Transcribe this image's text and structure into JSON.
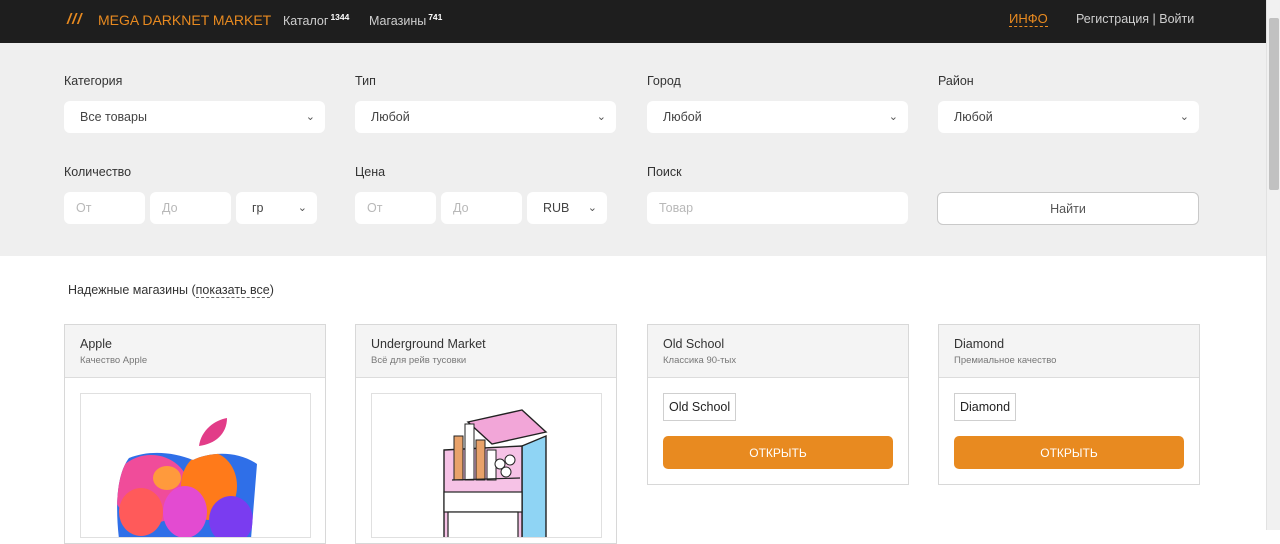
{
  "header": {
    "logo_mark": "///",
    "brand": "MEGA DARKNET MARKET",
    "catalog": {
      "label": "Каталог",
      "count": "1344"
    },
    "shops": {
      "label": "Магазины",
      "count": "741"
    },
    "info": "ИНФО",
    "auth": "Регистрация | Войти"
  },
  "filters": {
    "category": {
      "label": "Категория",
      "value": "Все товары"
    },
    "type": {
      "label": "Тип",
      "value": "Любой"
    },
    "city": {
      "label": "Город",
      "value": "Любой"
    },
    "district": {
      "label": "Район",
      "value": "Любой"
    },
    "quantity": {
      "label": "Количество",
      "from": "От",
      "to": "До",
      "unit": "гр"
    },
    "price": {
      "label": "Цена",
      "from": "От",
      "to": "До",
      "currency": "RUB"
    },
    "search": {
      "label": "Поиск",
      "placeholder": "Товар"
    },
    "submit": "Найти"
  },
  "trusted": {
    "text": "Надежные магазины (",
    "link": "показать все",
    "close": ")"
  },
  "shops": [
    {
      "title": "Apple",
      "subtitle": "Качество Apple"
    },
    {
      "title": "Underground Market",
      "subtitle": "Всё для рейв тусовки"
    },
    {
      "title": "Old School",
      "subtitle": "Классика 90-тых",
      "name_box": "Old School",
      "button": "ОТКРЫТЬ"
    },
    {
      "title": "Diamond",
      "subtitle": "Премиальное качество",
      "name_box": "Diamond",
      "button": "ОТКРЫТЬ"
    }
  ],
  "colors": {
    "accent": "#e88a20",
    "topbar": "#1e1e1e",
    "filters_bg": "#efefef"
  }
}
